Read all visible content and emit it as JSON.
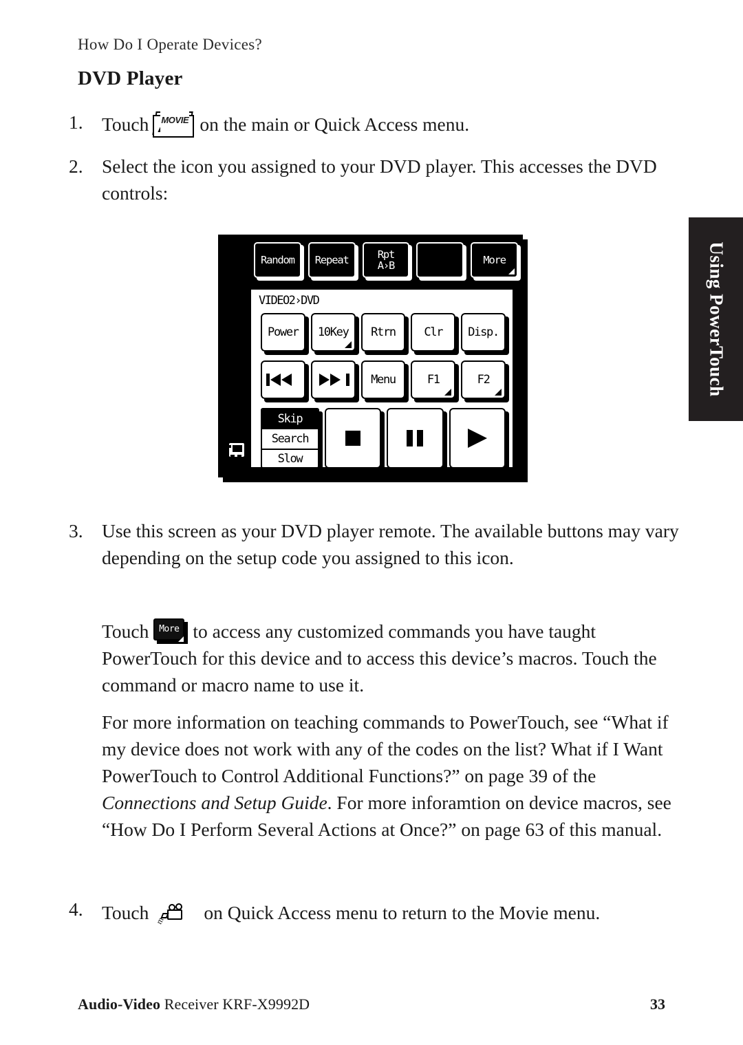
{
  "page": {
    "running_head": "How Do I Operate Devices?",
    "section_title": "DVD Player",
    "footer_left_bold": "Audio-Video",
    "footer_left_rest": " Receiver KRF-X9992D",
    "page_number": "33",
    "side_tab_label": "Using PowerTouch"
  },
  "steps": {
    "step1": {
      "number": "1.",
      "text_before": "Touch",
      "icon": "movie-button-icon",
      "icon_label": "MOVIE",
      "text_after": "on the main or Quick Access menu."
    },
    "step2": {
      "number": "2.",
      "text": "Select the icon you assigned to your DVD player. This accesses the DVD controls:"
    },
    "step3": {
      "number": "3.",
      "text": "Use this screen as your DVD player remote. The available buttons may vary depending on the setup code you assigned to this icon."
    },
    "step4": {
      "number": "4.",
      "text_before": "Touch",
      "icon": "quick-access-movie-icon",
      "icon_label": "movie",
      "text_after": "on Quick Access menu to return to the Movie menu."
    }
  },
  "paragraphs": {
    "more_before": "Touch",
    "more_icon_label": "More",
    "more_after": "to access any customized commands you have taught PowerTouch for this device and to access this device’s macros. Touch the command or macro name to use it.",
    "info_part1": "For more information on teaching commands to PowerTouch, see “What if my device does not work with any of the codes on the list? What if I Want PowerTouch to Control Additional Functions?” on page 39 of the ",
    "info_italic1": "Connections and Setup Guide",
    "info_part2": ". For more inforamtion on device macros, see “How Do I Perform Several Actions at Once?” on page 63 of this manual."
  },
  "lcd": {
    "screen_title": "VIDEO2›DVD",
    "top_row": [
      {
        "label": "Random",
        "corner": false
      },
      {
        "label": "Repeat",
        "corner": false
      },
      {
        "label": "Rpt\nA›B",
        "corner": false
      },
      {
        "label": "",
        "corner": false
      },
      {
        "label": "More",
        "corner": true
      }
    ],
    "row1": [
      {
        "label": "Power",
        "corner": false
      },
      {
        "label": "10Key",
        "corner": true
      },
      {
        "label": "Rtrn",
        "corner": false
      },
      {
        "label": "Clr",
        "corner": false
      },
      {
        "label": "Disp.",
        "corner": false
      }
    ],
    "row2": [
      {
        "label": "",
        "glyph": "prev-track-icon",
        "corner": false
      },
      {
        "label": "",
        "glyph": "next-track-icon",
        "corner": false
      },
      {
        "label": "Menu",
        "corner": false
      },
      {
        "label": "F1",
        "corner": true
      },
      {
        "label": "F2",
        "corner": true
      }
    ],
    "mode_selector": [
      {
        "label": "Skip",
        "selected": true
      },
      {
        "label": "Search",
        "selected": false
      },
      {
        "label": "Slow",
        "selected": false
      }
    ],
    "transport": [
      {
        "glyph": "stop-icon"
      },
      {
        "glyph": "pause-icon"
      },
      {
        "glyph": "play-icon"
      }
    ],
    "device_icon": "device-screen-icon"
  },
  "colors": {
    "ink": "#1a1a1a",
    "tab_background": "#231f20",
    "tab_text": "#ffffff",
    "lcd_black": "#000000",
    "lcd_white": "#ffffff"
  }
}
